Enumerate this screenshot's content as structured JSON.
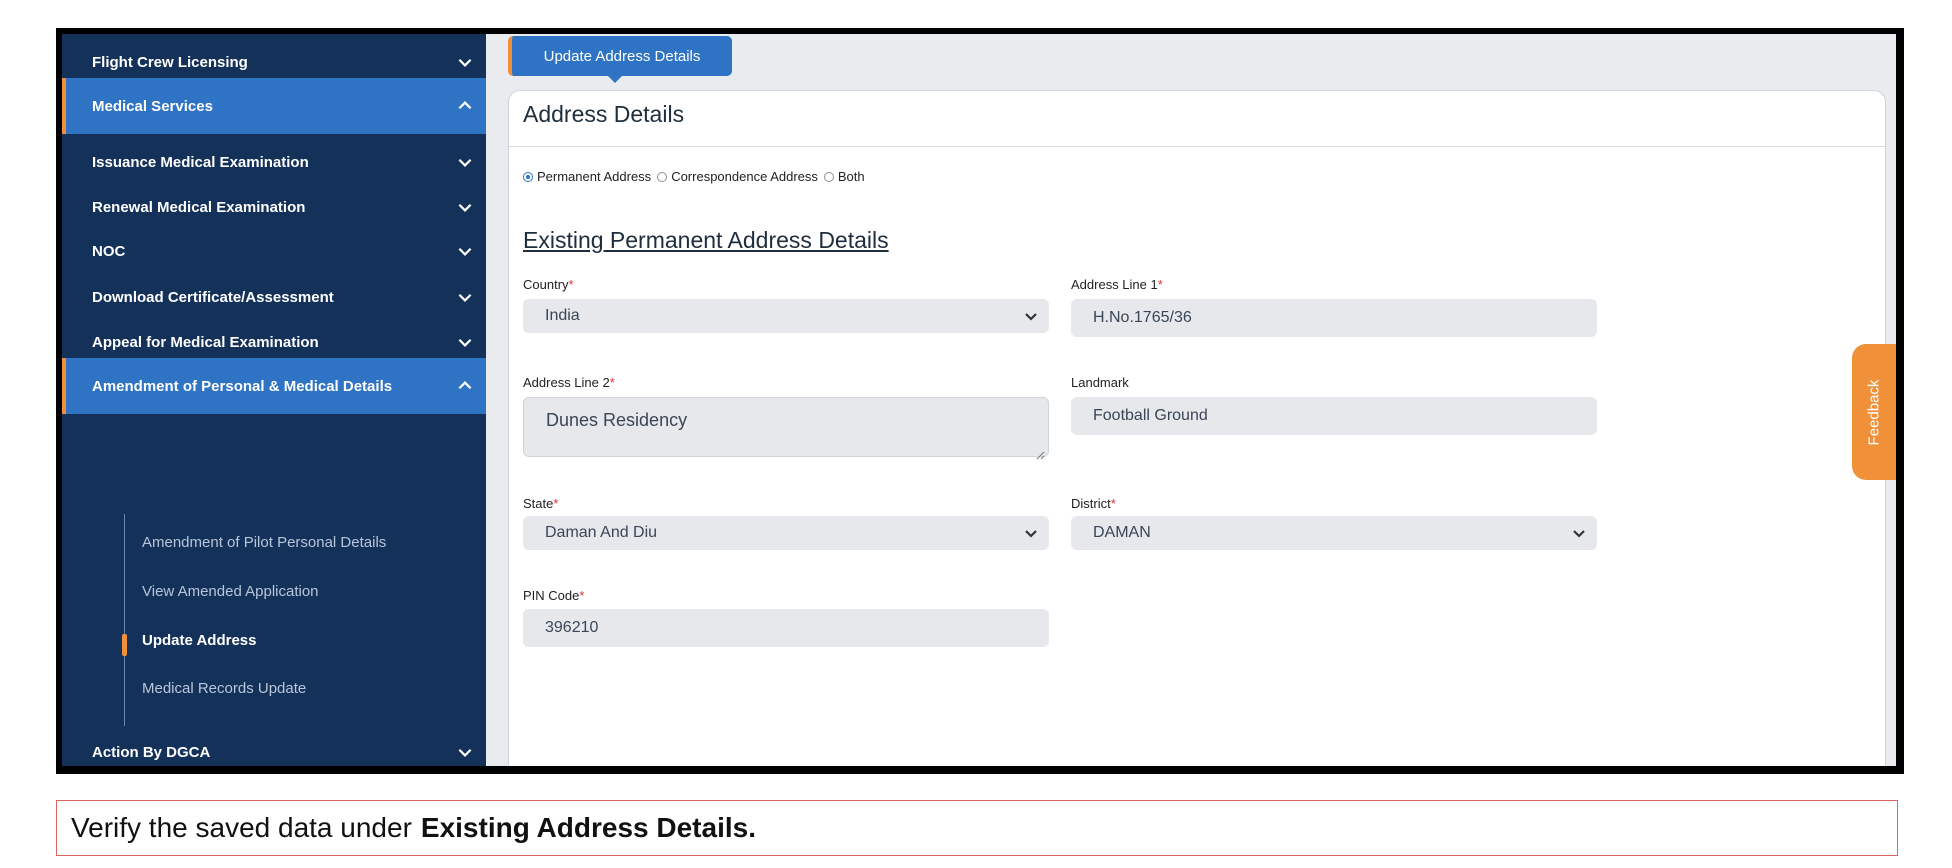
{
  "sidebar": {
    "items": [
      {
        "label": "Flight Crew Licensing",
        "state": "collapsed"
      },
      {
        "label": "Medical Services",
        "state": "expanded"
      },
      {
        "label": "Issuance Medical Examination",
        "state": "collapsed"
      },
      {
        "label": "Renewal Medical Examination",
        "state": "collapsed"
      },
      {
        "label": "NOC",
        "state": "collapsed"
      },
      {
        "label": "Download Certificate/Assessment",
        "state": "collapsed"
      },
      {
        "label": "Appeal for Medical Examination",
        "state": "collapsed"
      },
      {
        "label": "Amendment of Personal & Medical Details",
        "state": "expanded"
      },
      {
        "label": "Action By DGCA",
        "state": "collapsed"
      }
    ],
    "subitems": [
      {
        "label": "Amendment of Pilot Personal Details"
      },
      {
        "label": "View Amended Application"
      },
      {
        "label": "Update Address",
        "active": true
      },
      {
        "label": "Medical Records Update"
      }
    ]
  },
  "tab": {
    "label": "Update Address Details"
  },
  "card": {
    "title": "Address Details",
    "radio_options": [
      {
        "label": "Permanent Address",
        "selected": true
      },
      {
        "label": "Correspondence Address",
        "selected": false
      },
      {
        "label": "Both",
        "selected": false
      }
    ],
    "section_title": "Existing Permanent Address Details",
    "fields": {
      "country": {
        "label": "Country",
        "value": "India",
        "required": true
      },
      "address_line1": {
        "label": "Address Line 1",
        "value": "H.No.1765/36",
        "required": true
      },
      "address_line2": {
        "label": "Address Line 2",
        "value": "Dunes Residency",
        "required": true
      },
      "landmark": {
        "label": "Landmark",
        "value": "Football Ground",
        "required": false
      },
      "state": {
        "label": "State",
        "value": "Daman And Diu",
        "required": true
      },
      "district": {
        "label": "District",
        "value": "DAMAN",
        "required": true
      },
      "pin_code": {
        "label": "PIN Code",
        "value": "396210",
        "required": true
      }
    },
    "required_marker": "*"
  },
  "feedback": {
    "label": "Feedback"
  },
  "instruction": {
    "prefix": "Verify the saved data under",
    "emphasis": "Existing Address Details."
  },
  "colors": {
    "sidebar_bg": "#14315a",
    "active_bg": "#2f74c4",
    "accent": "#f0913a",
    "required": "#e0303a"
  },
  "icons": {
    "chevron_down": "chevron-down-icon",
    "chevron_up": "chevron-up-icon"
  }
}
